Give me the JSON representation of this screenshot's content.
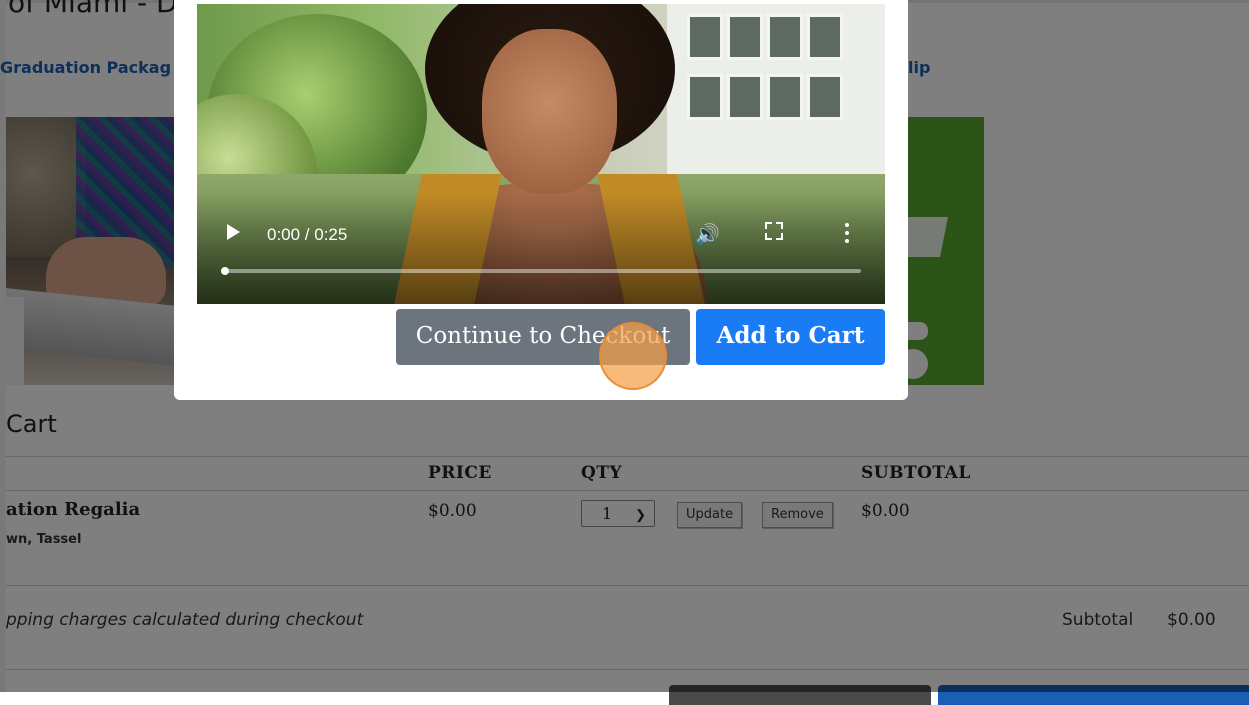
{
  "background": {
    "page_title": "of Miami - D",
    "nav_left": "Graduation Packag",
    "nav_right": "lip",
    "cart_title": "Cart",
    "table_headers": [
      "PRICE",
      "QTY",
      "SUBTOTAL"
    ],
    "item": {
      "name": "ation Regalia",
      "description": "wn, Tassel",
      "price": "$0.00",
      "qty": "1",
      "update_label": "Update",
      "remove_label": "Remove",
      "subtotal": "$0.00"
    },
    "shipping_note": "pping charges calculated during checkout",
    "summary": {
      "label": "Subtotal",
      "value": "$0.00"
    },
    "colors": {
      "link": "#1a5fb4",
      "promo_green": "#5aa830"
    }
  },
  "modal": {
    "video": {
      "time": "0:00 / 0:25",
      "progress": 0.0,
      "icons": [
        "play-icon",
        "volume-icon",
        "fullscreen-icon",
        "more-vert-icon"
      ]
    },
    "buttons": {
      "continue_label": "Continue to Checkout",
      "add_label": "Add to Cart"
    },
    "colors": {
      "continue_bg": "#6c757d",
      "add_bg": "#1a7cf5",
      "click_marker": "#f4a048"
    }
  }
}
